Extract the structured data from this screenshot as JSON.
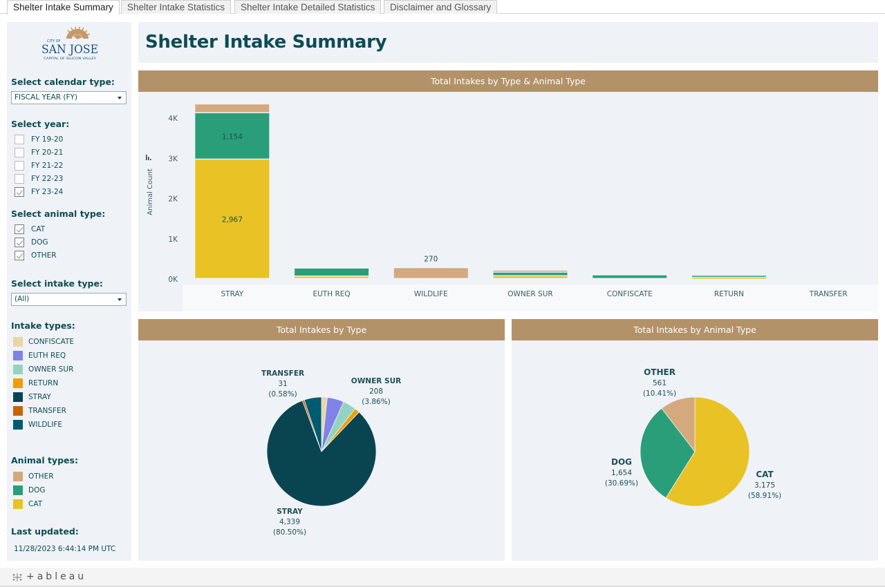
{
  "tabs": [
    {
      "label": "Shelter Intake Summary",
      "active": true
    },
    {
      "label": "Shelter Intake Statistics",
      "active": false
    },
    {
      "label": "Shelter Intake Detailed Statistics",
      "active": false
    },
    {
      "label": "Disclaimer and Glossary",
      "active": false
    }
  ],
  "logo": {
    "line1": "CITY OF",
    "line2": "SAN JOSE",
    "line3": "CAPITAL OF SILICON VALLEY"
  },
  "sidebar": {
    "calendar_label": "Select calendar type:",
    "calendar_value": "FISCAL YEAR (FY)",
    "year_label": "Select year:",
    "years": [
      {
        "label": "FY 19-20",
        "checked": false
      },
      {
        "label": "FY 20-21",
        "checked": false
      },
      {
        "label": "FY 21-22",
        "checked": false
      },
      {
        "label": "FY 22-23",
        "checked": false
      },
      {
        "label": "FY 23-24",
        "checked": true
      }
    ],
    "animal_label": "Select animal type:",
    "animals": [
      {
        "label": "CAT",
        "checked": true
      },
      {
        "label": "DOG",
        "checked": true
      },
      {
        "label": "OTHER",
        "checked": true
      }
    ],
    "intake_label": "Select intake type:",
    "intake_value": "(All)",
    "intake_legend_title": "Intake types:",
    "intake_legend": [
      {
        "label": "CONFISCATE",
        "color": "#e9d5a6"
      },
      {
        "label": "EUTH REQ",
        "color": "#7f83e8"
      },
      {
        "label": "OWNER SUR",
        "color": "#94d3bf"
      },
      {
        "label": "RETURN",
        "color": "#ee9e00"
      },
      {
        "label": "STRAY",
        "color": "#084550"
      },
      {
        "label": "TRANSFER",
        "color": "#c86400"
      },
      {
        "label": "WILDLIFE",
        "color": "#005a70"
      }
    ],
    "animal_legend_title": "Animal types:",
    "animal_legend": [
      {
        "label": "OTHER",
        "color": "#d3a97d"
      },
      {
        "label": "DOG",
        "color": "#2a9e78"
      },
      {
        "label": "CAT",
        "color": "#e9c325"
      }
    ],
    "updated_label": "Last updated:",
    "updated_value": "11/28/2023 6:44:14 PM UTC"
  },
  "page_title": "Shelter Intake Summary",
  "footer": {
    "brand": "+ableau"
  },
  "chart_data": [
    {
      "type": "bar",
      "stacked": true,
      "title": "Total Intakes by Type & Animal Type",
      "ylabel": "Animal Count",
      "xlabel": "",
      "ylim": [
        0,
        4400
      ],
      "yticks": [
        0,
        1000,
        2000,
        3000,
        4000
      ],
      "ytick_labels": [
        "0K",
        "1K",
        "2K",
        "3K",
        "4K"
      ],
      "categories": [
        "STRAY",
        "EUTH REQ",
        "WILDLIFE",
        "OWNER SUR",
        "CONFISCATE",
        "RETURN",
        "TRANSFER"
      ],
      "series": [
        {
          "name": "CAT",
          "color": "#e9c325",
          "values": [
            2967,
            60,
            0,
            68,
            0,
            35,
            0
          ]
        },
        {
          "name": "DOG",
          "color": "#2a9e78",
          "values": [
            1154,
            200,
            0,
            90,
            90,
            45,
            0
          ]
        },
        {
          "name": "OTHER",
          "color": "#d3a97d",
          "values": [
            218,
            0,
            270,
            50,
            0,
            0,
            0
          ]
        }
      ],
      "data_labels": [
        {
          "category": "STRAY",
          "series": "CAT",
          "text": "2,967"
        },
        {
          "category": "STRAY",
          "series": "DOG",
          "text": "1,154"
        },
        {
          "category": "WILDLIFE",
          "series": "OTHER",
          "text": "270",
          "position": "above"
        }
      ]
    },
    {
      "type": "pie",
      "title": "Total Intakes by Type",
      "slices": [
        {
          "label": "CONFISCATE",
          "value": 90,
          "color": "#e9d5a6"
        },
        {
          "label": "EUTH REQ",
          "value": 260,
          "color": "#7f83e8"
        },
        {
          "label": "OWNER SUR",
          "value": 208,
          "pct": "3.86%",
          "color": "#94d3bf",
          "show_label": true
        },
        {
          "label": "RETURN",
          "value": 80,
          "color": "#ee9e00"
        },
        {
          "label": "STRAY",
          "value": 4339,
          "pct": "80.50%",
          "color": "#084550",
          "show_label": true
        },
        {
          "label": "TRANSFER",
          "value": 31,
          "pct": "0.58%",
          "color": "#c86400",
          "show_label": true
        },
        {
          "label": "WILDLIFE",
          "value": 270,
          "color": "#005a70"
        }
      ],
      "annotations": [
        {
          "name": "TRANSFER",
          "value": "31",
          "pct": "(0.58%)"
        },
        {
          "name": "OWNER SUR",
          "value": "208",
          "pct": "(3.86%)"
        },
        {
          "name": "STRAY",
          "value": "4,339",
          "pct": "(80.50%)"
        }
      ]
    },
    {
      "type": "pie",
      "title": "Total Intakes by Animal Type",
      "slices": [
        {
          "label": "CAT",
          "value": 3175,
          "pct": "58.91%",
          "color": "#e9c325"
        },
        {
          "label": "DOG",
          "value": 1654,
          "pct": "30.69%",
          "color": "#2a9e78"
        },
        {
          "label": "OTHER",
          "value": 561,
          "pct": "10.41%",
          "color": "#d3a97d"
        }
      ],
      "annotations": [
        {
          "name": "OTHER",
          "value": "561",
          "pct": "(10.41%)"
        },
        {
          "name": "DOG",
          "value": "1,654",
          "pct": "(30.69%)"
        },
        {
          "name": "CAT",
          "value": "3,175",
          "pct": "(58.91%)"
        }
      ]
    }
  ]
}
